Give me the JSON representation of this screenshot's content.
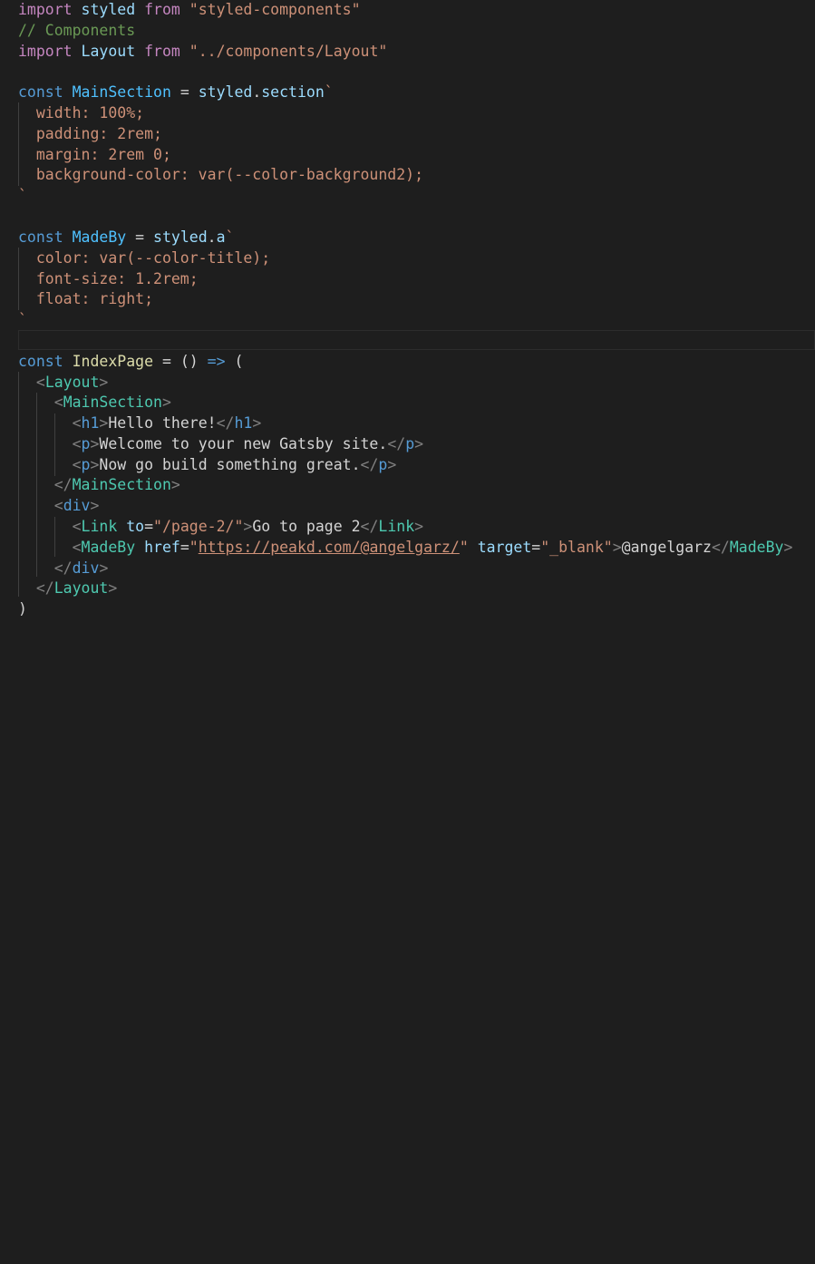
{
  "editor": {
    "language": "javascript",
    "lines": [
      "import styled from \"styled-components\"",
      "// Components",
      "import Layout from \"../components/Layout\"",
      "",
      "const MainSection = styled.section`",
      "  width: 100%;",
      "  padding: 2rem;",
      "  margin: 2rem 0;",
      "  background-color: var(--color-background2);",
      "`",
      "",
      "const MadeBy = styled.a`",
      "  color: var(--color-title);",
      "  font-size: 1.2rem;",
      "  float: right;",
      "`",
      "",
      "const IndexPage = () => (",
      "  <Layout>",
      "    <MainSection>",
      "      <h1>Hello there!</h1>",
      "      <p>Welcome to your new Gatsby site.</p>",
      "      <p>Now go build something great.</p>",
      "    </MainSection>",
      "    <div>",
      "      <Link to=\"/page-2/\">Go to page 2</Link>",
      "      <MadeBy href=\"https://peakd.com/@angelgarz/\" target=\"_blank\">@angelgarz</MadeBy>",
      "    </div>",
      "  </Layout>",
      ")"
    ]
  },
  "colors": {
    "background": "#1e1e1e",
    "keyword": "#569cd6",
    "string": "#ce9178",
    "comment": "#6a9955",
    "variable": "#9cdcfe",
    "component": "#4ec9b0",
    "function": "#dcdcaa",
    "punctuation": "#808080"
  }
}
